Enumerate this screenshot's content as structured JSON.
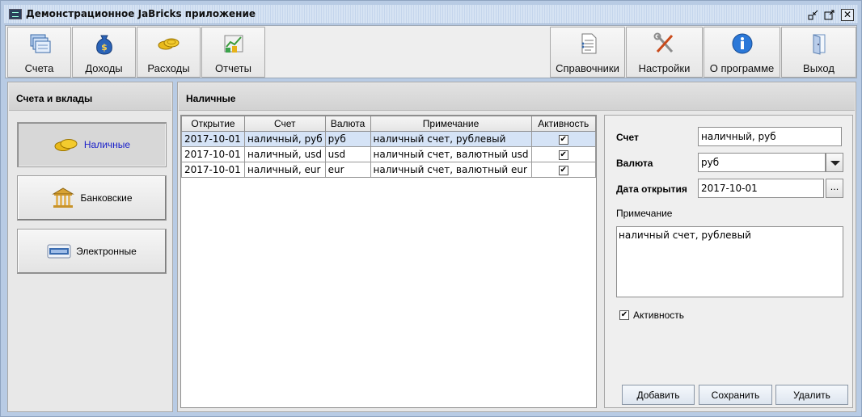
{
  "window": {
    "title": "Демонстрационное JaBricks приложение"
  },
  "toolbar": {
    "left": [
      {
        "label": "Счета",
        "icon": "accounts-icon"
      },
      {
        "label": "Доходы",
        "icon": "money-bag-icon"
      },
      {
        "label": "Расходы",
        "icon": "coins-icon"
      },
      {
        "label": "Отчеты",
        "icon": "report-chart-icon"
      }
    ],
    "right": [
      {
        "label": "Справочники",
        "icon": "reference-document-icon"
      },
      {
        "label": "Настройки",
        "icon": "tools-icon"
      },
      {
        "label": "О программе",
        "icon": "info-icon"
      },
      {
        "label": "Выход",
        "icon": "exit-door-icon"
      }
    ]
  },
  "sidebar": {
    "title": "Счета и вклады",
    "items": [
      {
        "label": "Наличные",
        "icon": "coins-icon",
        "active": true
      },
      {
        "label": "Банковские",
        "icon": "bank-icon",
        "active": false
      },
      {
        "label": "Электронные",
        "icon": "paypal-icon",
        "active": false
      }
    ]
  },
  "main": {
    "title": "Наличные",
    "table": {
      "columns": [
        "Открытие",
        "Счет",
        "Валюта",
        "Примечание",
        "Активность"
      ],
      "rows": [
        {
          "opened": "2017-10-01",
          "account": "наличный, руб",
          "currency": "руб",
          "note": "наличный счет, рублевый",
          "active": true,
          "selected": true
        },
        {
          "opened": "2017-10-01",
          "account": "наличный, usd",
          "currency": "usd",
          "note": "наличный счет, валютный usd",
          "active": true,
          "selected": false
        },
        {
          "opened": "2017-10-01",
          "account": "наличный, eur",
          "currency": "eur",
          "note": "наличный счет, валютный eur",
          "active": true,
          "selected": false
        }
      ]
    }
  },
  "form": {
    "account_label": "Счет",
    "account_value": "наличный, руб",
    "currency_label": "Валюта",
    "currency_value": "руб",
    "date_label": "Дата открытия",
    "date_value": "2017-10-01",
    "date_button": "...",
    "note_label": "Примечание",
    "note_value": "наличный счет, рублевый",
    "active_label": "Активность",
    "active_checked": true,
    "add_label": "Добавить",
    "save_label": "Сохранить",
    "delete_label": "Удалить"
  },
  "colors": {
    "selection": "#d5e3f6",
    "active_item_text": "#1a20c9"
  }
}
